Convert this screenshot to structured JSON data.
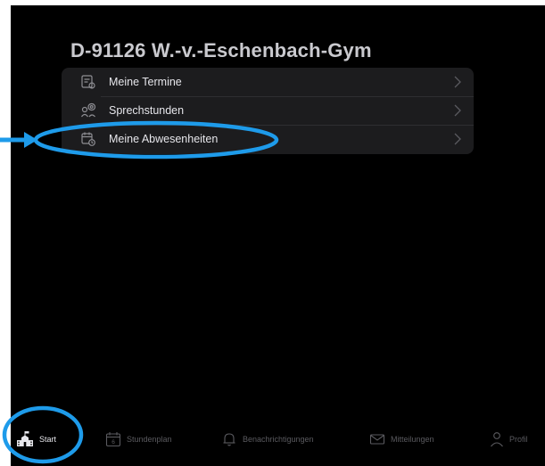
{
  "school": {
    "title": "D-91126 W.-v.-Eschenbach-Gym"
  },
  "menu": {
    "items": [
      {
        "label": "Meine Termine",
        "icon": "calendar-doc-icon"
      },
      {
        "label": "Sprechstunden",
        "icon": "people-speech-icon"
      },
      {
        "label": "Meine Abwesenheiten",
        "icon": "calendar-clock-icon"
      }
    ]
  },
  "tabbar": {
    "active": "Start",
    "tabs": [
      {
        "label": "Start",
        "icon": "school-icon"
      },
      {
        "label": "Stundenplan",
        "icon": "calendar-icon"
      },
      {
        "label": "Benachrichtigungen",
        "icon": "bell-icon"
      },
      {
        "label": "Mitteilungen",
        "icon": "envelope-icon"
      },
      {
        "label": "Profil",
        "icon": "person-icon"
      }
    ]
  },
  "annotation": {
    "color": "#1e9bea"
  },
  "colors": {
    "background": "#000000",
    "card": "#1c1c1e",
    "text": "#e6e6eb",
    "title": "#c9c9ce",
    "inactive_tab": "#5a5a5f"
  }
}
